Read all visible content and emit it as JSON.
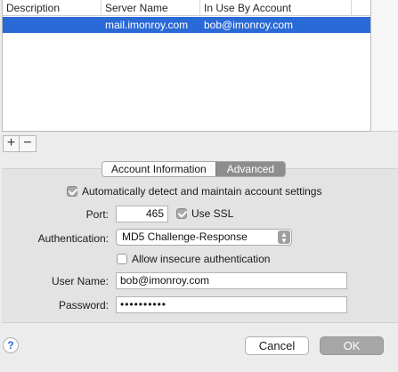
{
  "table": {
    "headers": [
      "Description",
      "Server Name",
      "In Use By Account"
    ],
    "rows": [
      {
        "description": "",
        "server_name": "mail.imonroy.com",
        "account": "bob@imonroy.com"
      }
    ],
    "selection_color": "#2a6ad6"
  },
  "list_controls": {
    "add_symbol": "+",
    "remove_symbol": "−"
  },
  "tabs": [
    {
      "label": "Account Information",
      "active": true
    },
    {
      "label": "Advanced",
      "active": false
    }
  ],
  "settings": {
    "auto_detect_label": "Automatically detect and maintain account settings",
    "auto_detect_checked": true,
    "port_label": "Port:",
    "port_value": "465",
    "use_ssl_label": "Use SSL",
    "use_ssl_checked": true,
    "authentication_label": "Authentication:",
    "authentication_value": "MD5 Challenge-Response",
    "allow_insecure_label": "Allow insecure authentication",
    "allow_insecure_checked": false,
    "username_label": "User Name:",
    "username_value": "bob@imonroy.com",
    "password_label": "Password:",
    "password_value": "••••••••••"
  },
  "footer": {
    "help_symbol": "?",
    "cancel_label": "Cancel",
    "ok_label": "OK"
  }
}
